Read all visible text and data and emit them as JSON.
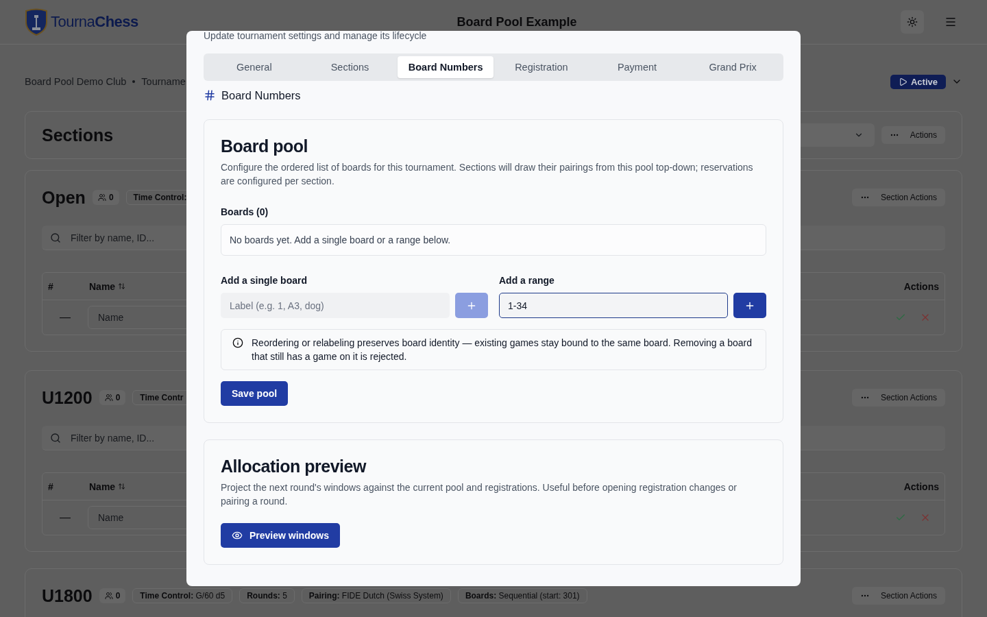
{
  "header": {
    "logo_text": "Tourna**Chess**",
    "title": "Board Pool Example"
  },
  "breadcrumb": [
    "Board Pool Demo Club",
    "Tourname"
  ],
  "status_button": {
    "label": "Active"
  },
  "sections_panel": {
    "title": "Sections",
    "actions_label": "Actions"
  },
  "sections": [
    {
      "name": "Open",
      "count": "0",
      "chips": [
        {
          "label": "Time Control:"
        }
      ],
      "actions_label": "Section Actions",
      "filter_placeholder": "Filter by name, ID...",
      "columns": [
        "#",
        "Name",
        "Actions"
      ],
      "row": {
        "index": "—",
        "name_placeholder": "Name"
      }
    },
    {
      "name": "U1200",
      "count": "0",
      "chips": [
        {
          "label": "Time Contr"
        }
      ],
      "actions_label": "Section Actions",
      "filter_placeholder": "Filter by name, ID...",
      "columns": [
        "#",
        "Name",
        "Actions"
      ],
      "row": {
        "index": "—",
        "name_placeholder": "Name"
      }
    },
    {
      "name": "U1800",
      "count": "0",
      "chips": [
        {
          "label": "Time Control:",
          "value": "G/60 d5"
        },
        {
          "label": "Rounds:",
          "value": "5"
        },
        {
          "label": "Pairing:",
          "value": "FIDE Dutch (Swiss System)"
        },
        {
          "label": "Boards:",
          "value": "Sequential (start: 301)"
        }
      ],
      "actions_label": "Section Actions"
    }
  ],
  "dialog": {
    "subtitle": "Update tournament settings and manage its lifecycle",
    "tabs": [
      {
        "label": "General",
        "selected": false
      },
      {
        "label": "Sections",
        "selected": false
      },
      {
        "label": "Board Numbers",
        "selected": true
      },
      {
        "label": "Registration",
        "selected": false
      },
      {
        "label": "Payment",
        "selected": false
      },
      {
        "label": "Grand Prix",
        "selected": false
      }
    ],
    "heading": "Board Numbers",
    "board_pool": {
      "title": "Board pool",
      "description": "Configure the ordered list of boards for this tournament. Sections will draw their pairings from this pool top-down; reservations are configured per section.",
      "boards_label": "Boards (0)",
      "empty_text": "No boards yet. Add a single board or a range below.",
      "single": {
        "label": "Add a single board",
        "placeholder": "Label (e.g. 1, A3, dog)",
        "focused": false,
        "add_disabled": true
      },
      "range": {
        "label": "Add a range",
        "value": "1-34",
        "focused": true,
        "add_disabled": false
      },
      "note": "Reordering or relabeling preserves board identity — existing games stay bound to the same board. Removing a board that still has a game on it is rejected.",
      "save_label": "Save pool"
    },
    "preview": {
      "title": "Allocation preview",
      "description": "Project the next round's windows against the current pool and registrations. Useful before opening registration changes or pairing a round.",
      "button_label": "Preview windows"
    }
  }
}
